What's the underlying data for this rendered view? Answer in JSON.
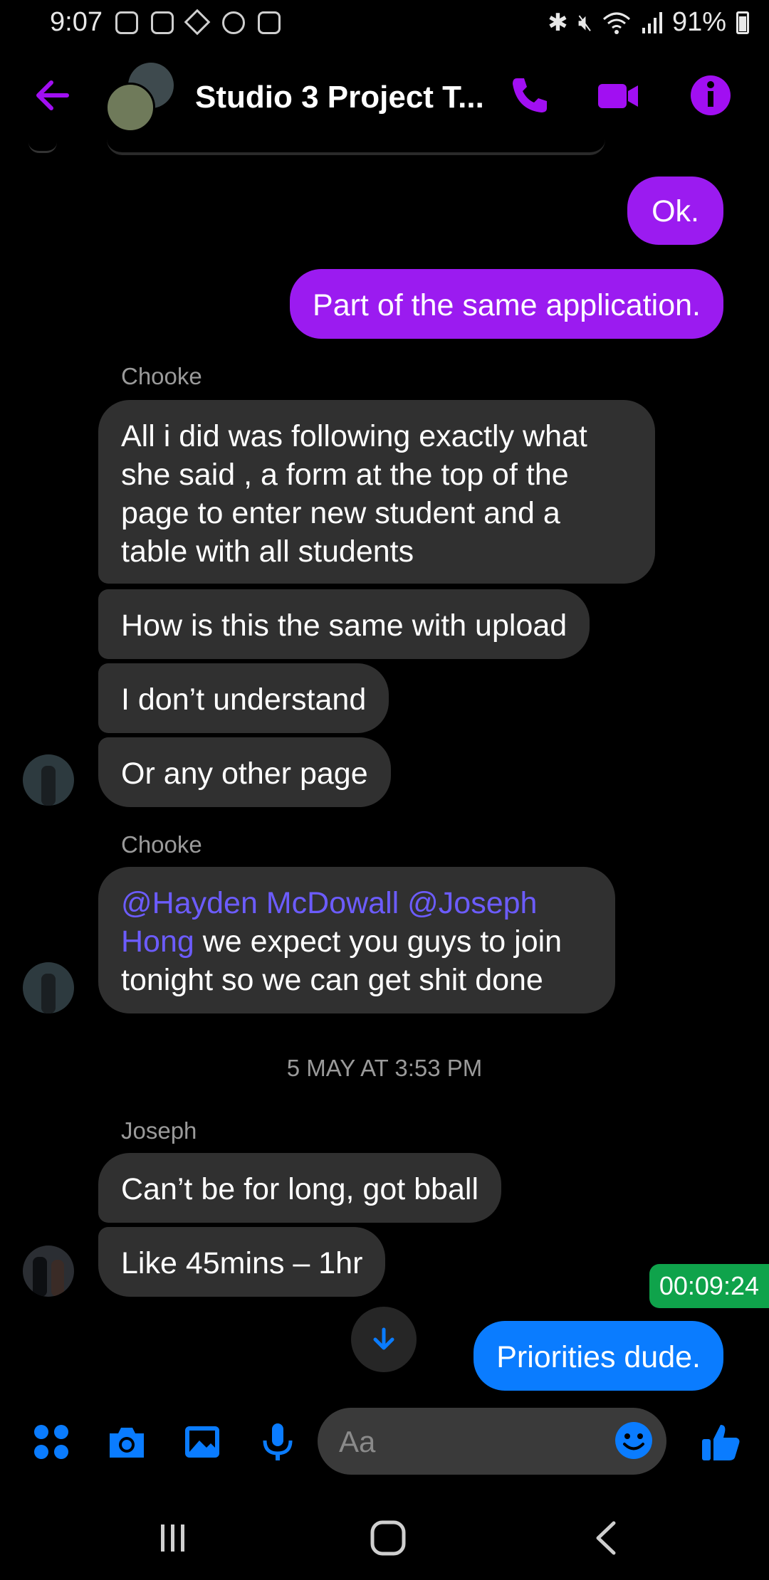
{
  "status_bar": {
    "time": "9:07",
    "battery_percent": "91%",
    "icons": [
      "notification-icon",
      "notification-icon",
      "binance-icon",
      "messenger-icon",
      "notification-icon",
      "bluetooth-icon",
      "mute-icon",
      "wifi-icon",
      "signal-icon",
      "battery-icon"
    ]
  },
  "header": {
    "title": "Studio 3 Project T...",
    "accent_color": "#a10ff2"
  },
  "messages": {
    "out_1": "Ok.",
    "out_2": "Part of the same application.",
    "group1_sender": "Chooke",
    "group1": [
      "All i did was following exactly what",
      "she said , a form at the top of the",
      "page to enter new student  and a",
      "table with all students"
    ],
    "group1_b": "How is this the same with upload",
    "group1_c": "I don’t understand",
    "group1_d": "Or any other page",
    "group2_sender": "Chooke",
    "group2": {
      "mention1": "@Hayden McDowall",
      "mention2a": "@Joseph",
      "mention2b": "Hong",
      "line1_rest": " we expect you guys to join",
      "line2": "tonight so we can get shit done"
    },
    "timestamp": "5 MAY AT 3:53 PM",
    "group3_sender": "Joseph",
    "group3_a": "Can’t be for long, got bball",
    "group3_b": "Like 45mins – 1hr",
    "out_3": "Priorities dude."
  },
  "timer": "00:09:24",
  "composer": {
    "placeholder": "Aa",
    "accent_color": "#0a7cff"
  }
}
